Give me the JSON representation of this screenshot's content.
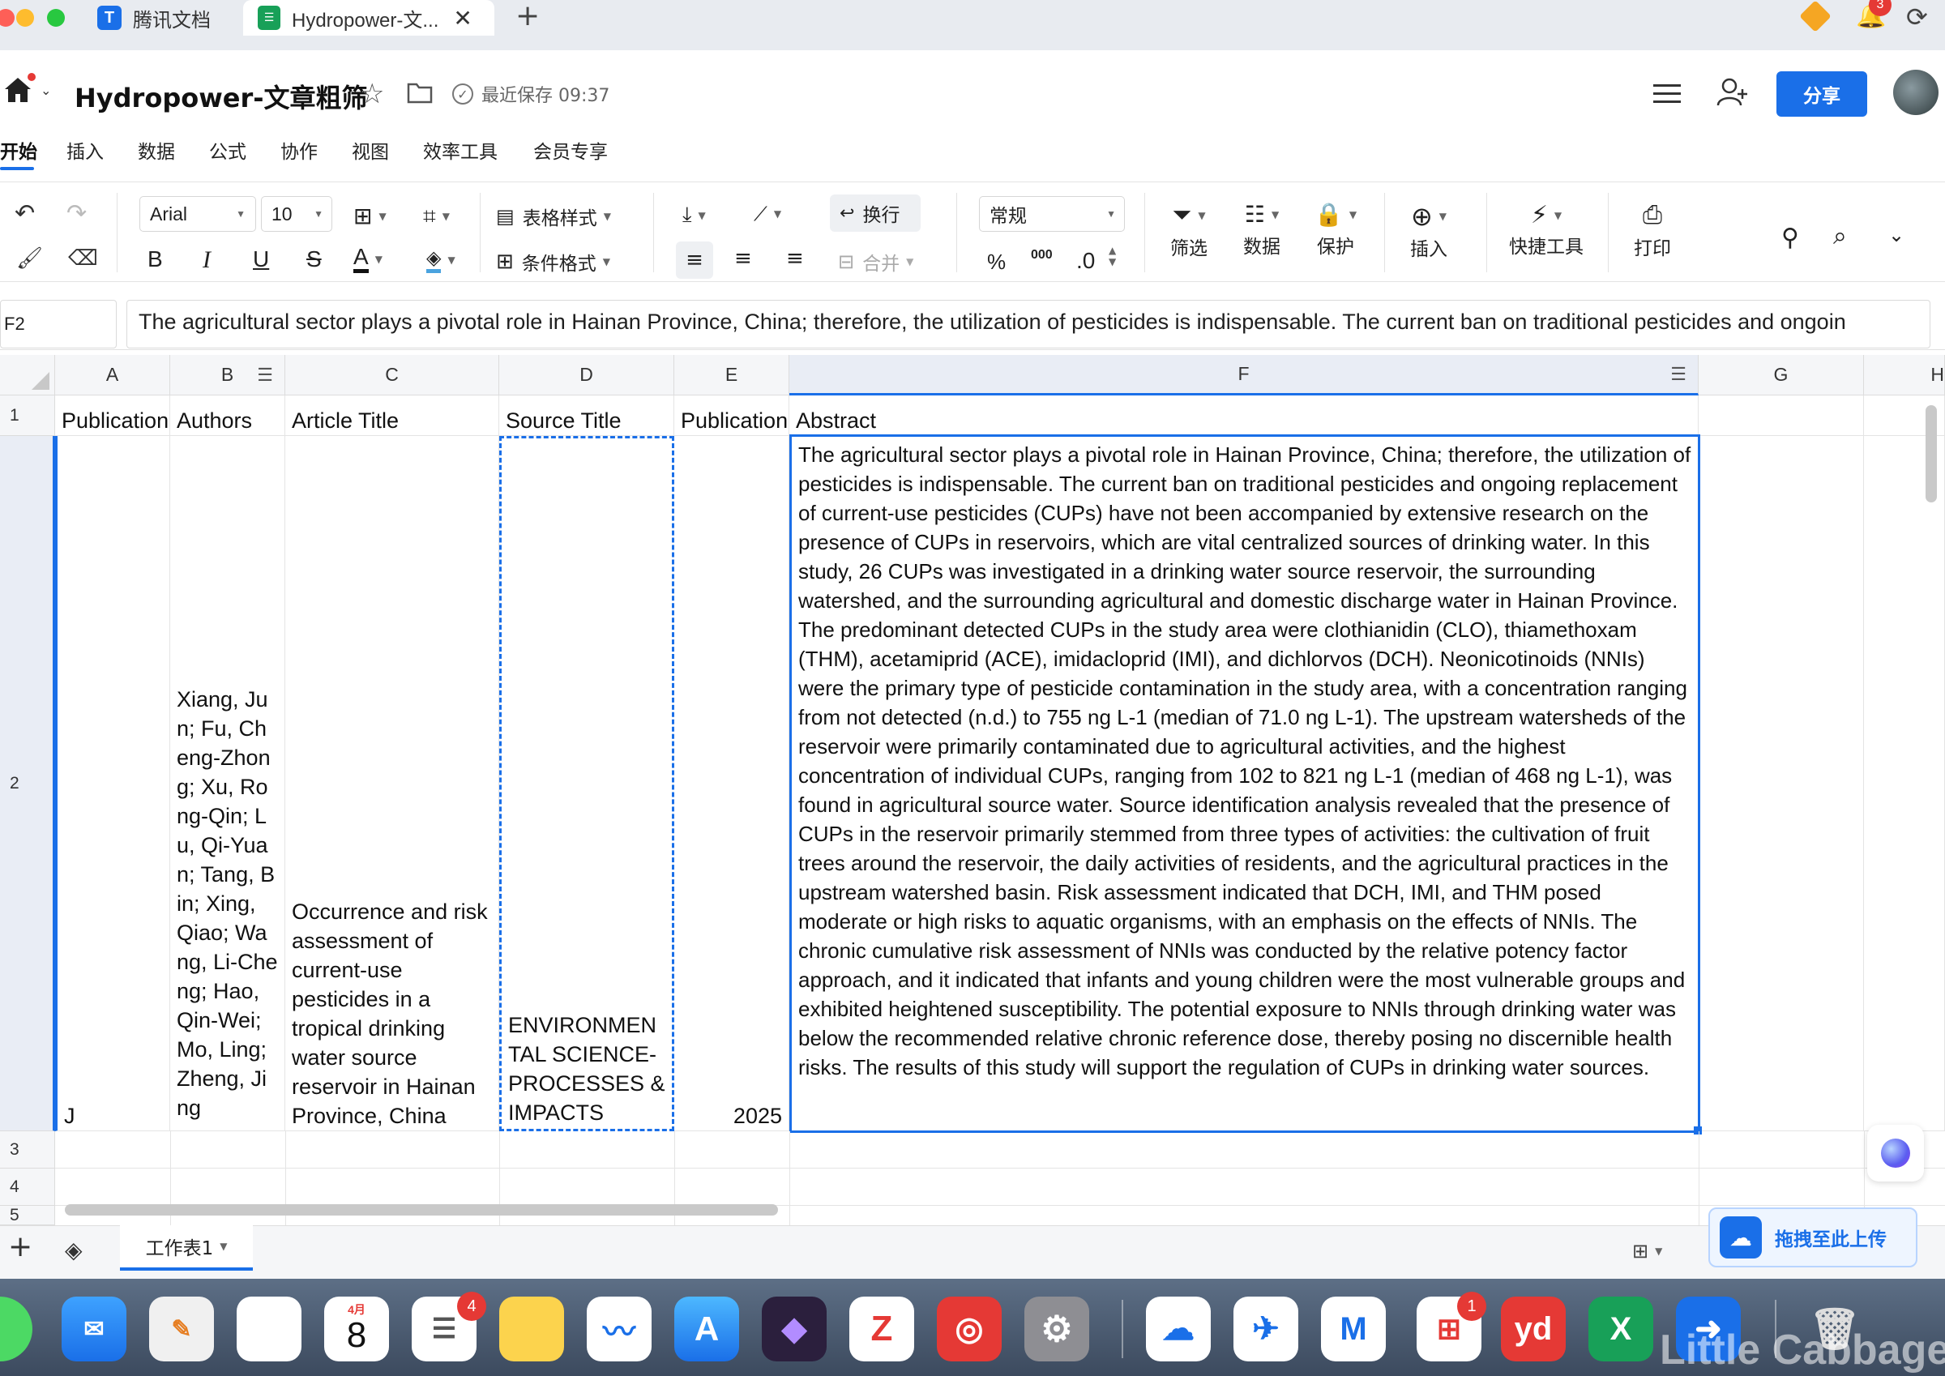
{
  "tabs": [
    {
      "label": "腾讯文档"
    },
    {
      "label": "Hydropower-文..."
    }
  ],
  "notification_count": "3",
  "header": {
    "title": "Hydropower-文章粗筛",
    "save_status": "最近保存 09:37",
    "share": "分享"
  },
  "menu": [
    "开始",
    "插入",
    "数据",
    "公式",
    "协作",
    "视图",
    "效率工具",
    "会员专享"
  ],
  "toolbar": {
    "font": "Arial",
    "font_size": "10",
    "table_style": "表格样式",
    "cond_format": "条件格式",
    "wrap": "换行",
    "merge": "合并",
    "number_format": "常规",
    "percent": "%",
    "thousands": "000",
    "decimal": ".0",
    "filter": "筛选",
    "data": "数据",
    "protect": "保护",
    "insert": "插入",
    "quick_tools": "快捷工具",
    "print": "打印",
    "bold": "B",
    "italic": "I",
    "underline": "U",
    "strike": "S",
    "font_color": "A"
  },
  "formula_bar": {
    "cell_ref": "F2",
    "content": "The agricultural sector plays a pivotal role in Hainan Province, China; therefore, the utilization of pesticides is indispensable. The current ban on traditional pesticides and ongoin"
  },
  "columns": [
    "A",
    "B",
    "C",
    "D",
    "E",
    "F",
    "G",
    "H"
  ],
  "rows": [
    "1",
    "2",
    "3",
    "4",
    "5"
  ],
  "cells": {
    "A1": "Publication",
    "B1": "Authors",
    "C1": "Article Title",
    "D1": "Source Title",
    "E1": "Publication",
    "F1": "Abstract",
    "A2": "J",
    "B2": "Xiang, Jun; Fu, Cheng-Zhong; Xu, Rong-Qin; Lu, Qi-Yuan; Tang, Bin; Xing, Qiao; Wang, Li-Cheng; Hao, Qin-Wei; Mo, Ling; Zheng, Jing",
    "C2": "Occurrence and risk assessment of current-use pesticides in a tropical drinking water source reservoir in Hainan Province, China",
    "D2": "ENVIRONMENTAL SCIENCE-PROCESSES & IMPACTS",
    "E2": "2025",
    "F2": "The agricultural sector plays a pivotal role in Hainan Province, China; therefore, the utilization of pesticides is indispensable. The current ban on traditional pesticides and ongoing replacement of current-use pesticides (CUPs) have not been accompanied by extensive research on the presence of CUPs in reservoirs, which are vital centralized sources of drinking water. In this study, 26 CUPs was investigated in a drinking water source reservoir, the surrounding watershed, and the surrounding agricultural and domestic discharge water in Hainan Province. The predominant detected CUPs in the study area were clothianidin (CLO), thiamethoxam (THM), acetamiprid (ACE), imidacloprid (IMI), and dichlorvos (DCH). Neonicotinoids (NNIs) were the primary type of pesticide contamination in the study area, with a concentration ranging from not detected (n.d.) to 755 ng L-1 (median of 71.0 ng L-1). The upstream watersheds of the reservoir were primarily contaminated due to agricultural activities, and the highest concentration of individual CUPs, ranging from 102 to 821 ng L-1 (median of 468 ng L-1), was found in agricultural source water. Source identification analysis revealed that the presence of CUPs in the reservoir primarily stemmed from three types of activities: the cultivation of fruit trees around the reservoir, the daily activities of residents, and the agricultural practices in the upstream watershed basin. Risk assessment indicated that DCH, IMI, and THM posed moderate or high risks to aquatic organisms, with an emphasis on the effects of NNIs. The chronic cumulative risk assessment of NNIs was conducted by the relative potency factor approach, and it indicated that infants and young children were the most vulnerable groups and exhibited heightened susceptibility. The potential exposure to NNIs through drinking water was below the recommended relative chronic reference dose, thereby posing no discernible health risks. The results of this study will support the regulation of CUPs in drinking water sources."
  },
  "sheet_tab": "工作表1",
  "upload_button": "拖拽至此上传",
  "dock": {
    "calendar_month": "4月",
    "calendar_day": "8",
    "reminders_badge": "4",
    "wps_badge": "1",
    "watermark": "Little Cabbage"
  },
  "colors": {
    "accent": "#1a6fe8",
    "selection": "#1a6fe8",
    "sheets_green": "#18a058"
  }
}
